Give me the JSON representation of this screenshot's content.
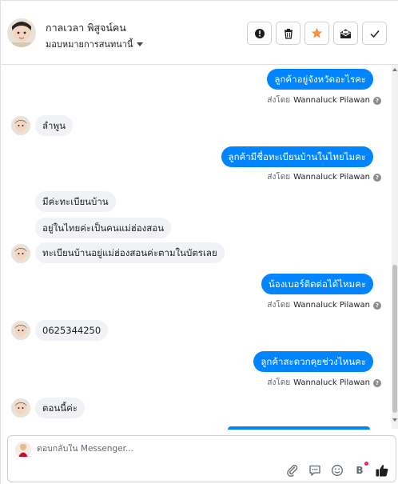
{
  "header": {
    "contact_name": "กาลเวลา พิสูจน์คน",
    "assign_label": "มอบหมายการสนทนานี้",
    "actions": [
      {
        "name": "alert",
        "icon": "exclamation-icon"
      },
      {
        "name": "delete",
        "icon": "trash-icon"
      },
      {
        "name": "star",
        "icon": "star-icon",
        "color": "#f7923b"
      },
      {
        "name": "mark-unread",
        "icon": "envelope-icon"
      },
      {
        "name": "done",
        "icon": "check-icon"
      }
    ]
  },
  "messages": [
    {
      "dir": "out",
      "text": "ลูกค้าอยู่จังหวัดอะไรคะ",
      "sent_by_prefix": "ส่งโดย",
      "agent": "Wannaluck Pilawan"
    },
    {
      "dir": "in",
      "text": "ลำพูน"
    },
    {
      "dir": "out",
      "text": "ลูกค้ามีชื่อทะเบียนบ้านในไทยไมคะ",
      "sent_by_prefix": "ส่งโดย",
      "agent": "Wannaluck Pilawan"
    },
    {
      "dir": "in",
      "text": "มีค่ะทะเบียนบ้าน"
    },
    {
      "dir": "in",
      "text": "อยู่ในไทยค่ะเป็นคนแม่ฮ่องสอน"
    },
    {
      "dir": "in",
      "text": "ทะเบียนบ้านอยู่แม่ฮ่องสอนค่ะตามในบัตรเลย"
    },
    {
      "dir": "out",
      "text": "น้องเบอร์ติดต่อได้ไหมคะ",
      "sent_by_prefix": "ส่งโดย",
      "agent": "Wannaluck Pilawan"
    },
    {
      "dir": "in",
      "text": "0625344250"
    },
    {
      "dir": "out",
      "text": "ลูกค้าสะดวกคุยช่วงไหนคะ",
      "sent_by_prefix": "ส่งโดย",
      "agent": "Wannaluck Pilawan"
    },
    {
      "dir": "in",
      "text": "ตอนนี้ค่ะ"
    }
  ],
  "composer": {
    "placeholder": "ตอบกลับใน Messenger...",
    "value": "",
    "tools": [
      "paperclip-icon",
      "saved-reply-icon",
      "emoji-icon",
      "brand-b-icon",
      "thumbs-up-icon"
    ],
    "brand_b_glyph": "B"
  },
  "colors": {
    "outgoing_bubble": "#0084ff",
    "incoming_bubble": "#f0f2f5",
    "notification_dot": "#f02849"
  }
}
